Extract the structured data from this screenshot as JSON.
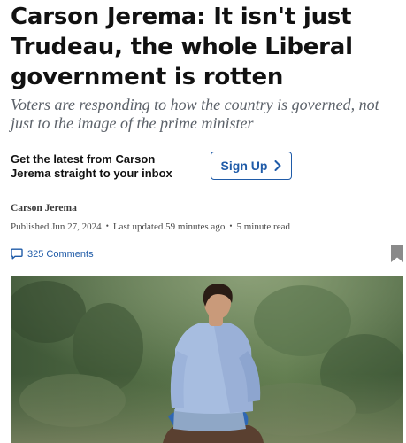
{
  "article": {
    "headline": "Carson Jerema: It isn't just Trudeau, the whole Liberal government is rotten",
    "dek": "Voters are responding to how the country is governed, not just to the image of the prime minister"
  },
  "newsletter": {
    "text": "Get the latest from Carson Jerema straight to your inbox",
    "button_label": "Sign Up",
    "button_icon": "chevron-right-icon"
  },
  "byline": {
    "author": "Carson Jerema",
    "published": "Published Jun 27, 2024",
    "separator": "•",
    "updated": "Last updated 59 minutes ago",
    "read_time": "5 minute read"
  },
  "engagement": {
    "comments_label": "325 Comments",
    "comments_icon": "comment-icon",
    "bookmark_icon": "bookmark-icon"
  },
  "colors": {
    "accent": "#1f5ba8",
    "dek": "#5b6169",
    "bookmark": "#8a8a8a"
  }
}
